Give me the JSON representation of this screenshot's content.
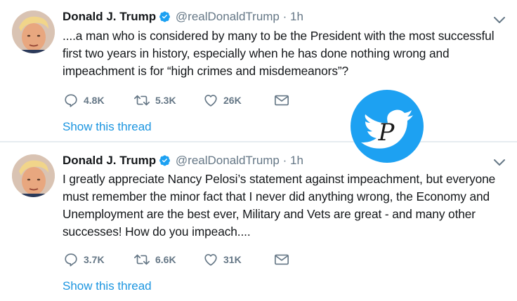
{
  "tweets": [
    {
      "name": "Donald J. Trump",
      "handle": "@realDonaldTrump",
      "separator": "·",
      "time": "1h",
      "text": "....a man who is considered by many to be the President with the most successful first two years in history, especially when he has done nothing wrong and impeachment is for “high crimes and misdemeanors”?",
      "replies": "4.8K",
      "retweets": "5.3K",
      "likes": "26K",
      "show_thread": "Show this thread"
    },
    {
      "name": "Donald J. Trump",
      "handle": "@realDonaldTrump",
      "separator": "·",
      "time": "1h",
      "text": "I greatly appreciate Nancy Pelosi’s statement against impeachment, but everyone must remember the minor fact that I never did anything wrong, the Economy and Unemployment are the best ever, Military and Vets are great - and many other successes! How do you impeach....",
      "replies": "3.7K",
      "retweets": "6.6K",
      "likes": "31K",
      "show_thread": "Show this thread"
    }
  ],
  "icons": {
    "verified": "verified-badge-icon",
    "caret": "chevron-down-icon",
    "reply": "reply-icon",
    "retweet": "retweet-icon",
    "like": "heart-icon",
    "message": "envelope-icon",
    "watermark": "twitter-bird-logo"
  },
  "watermark_letter": "P",
  "colors": {
    "accent": "#1da1f2",
    "link": "#1b95e0",
    "muted": "#657786",
    "text": "#14171a"
  }
}
